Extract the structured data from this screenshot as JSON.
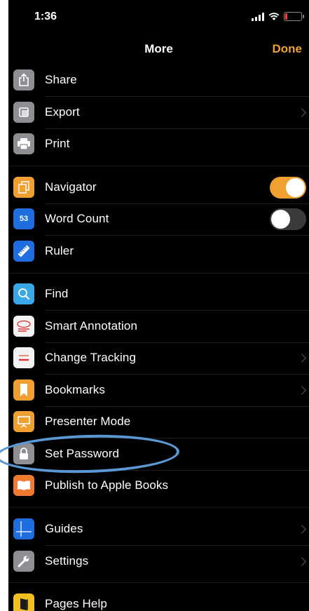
{
  "status": {
    "time": "1:36"
  },
  "nav": {
    "title": "More",
    "done": "Done"
  },
  "menu": {
    "share": "Share",
    "export": "Export",
    "print": "Print",
    "navigator": "Navigator",
    "word_count": "Word Count",
    "word_count_badge": "53",
    "ruler": "Ruler",
    "find": "Find",
    "smart_annotation": "Smart Annotation",
    "change_tracking": "Change Tracking",
    "bookmarks": "Bookmarks",
    "presenter_mode": "Presenter Mode",
    "set_password": "Set Password",
    "publish": "Publish to Apple Books",
    "guides": "Guides",
    "settings": "Settings",
    "pages_help": "Pages Help"
  },
  "icons": {
    "share": "share-icon",
    "export": "export-icon",
    "print": "printer-icon",
    "navigator": "navigator-icon",
    "ruler": "ruler-icon",
    "find": "magnifier-icon",
    "smart_annotation": "annotation-icon",
    "change_tracking": "tracking-icon",
    "bookmarks": "bookmark-icon",
    "presenter_mode": "presenter-icon",
    "set_password": "lock-icon",
    "publish": "book-icon",
    "guides": "guides-icon",
    "settings": "wrench-icon",
    "pages_help": "help-book-icon"
  },
  "toggles": {
    "navigator": true,
    "word_count": false
  },
  "colors": {
    "accent": "#f0a030",
    "background": "#000000",
    "highlight": "#5b97d3",
    "battery_low": "#ff3b30"
  }
}
